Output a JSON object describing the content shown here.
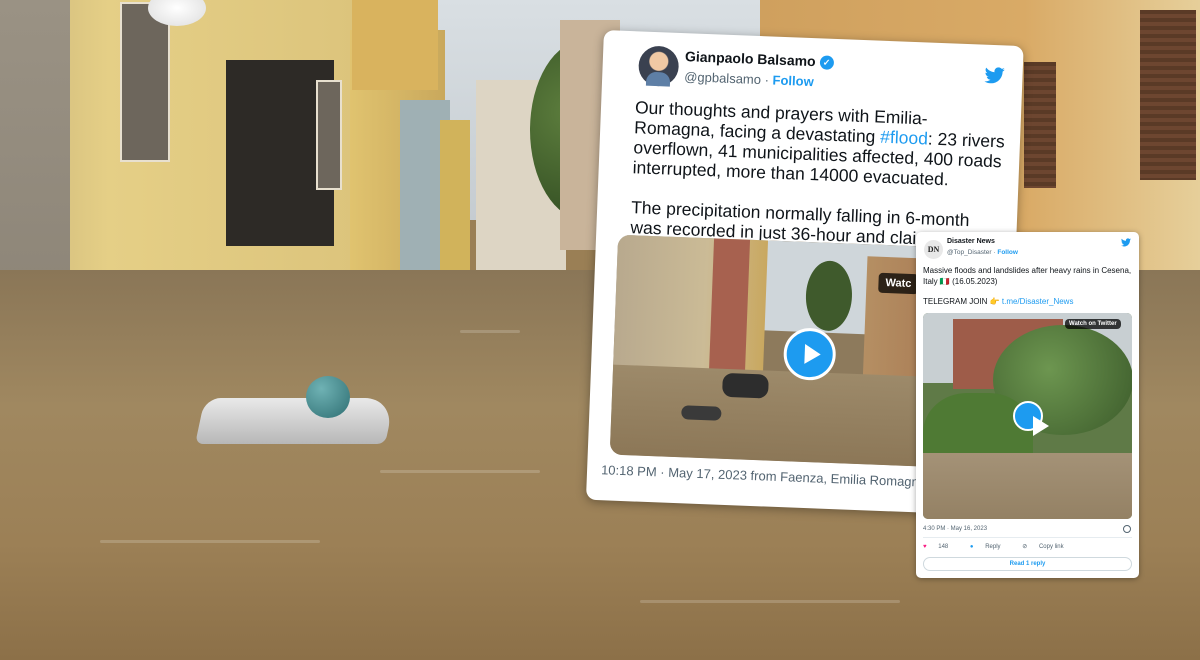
{
  "main_tweet": {
    "author_name": "Gianpaolo Balsamo",
    "verified_mark": "✓",
    "handle": "@gpbalsamo",
    "separator": "·",
    "follow_label": "Follow",
    "text_before_hashtag": "Our thoughts and prayers with Emilia-Romagna, facing a devastating ",
    "hashtag": "#flood",
    "text_after_hashtag": ": 23 rivers overflown, 41 municipalities affected, 400 roads interrupted, more than 14000 evacuated.",
    "text_paragraph_2": "The precipitation normally falling in 6-month was recorded in just 36-hour and claimed already 9 lives.",
    "video_badge": "Watc",
    "timestamp": "10:18 PM · May 17, 2023 from Faenza, Emilia Romagna"
  },
  "embedded_tweet": {
    "logo_text": "DN",
    "author_name": "Disaster News",
    "handle": "@Top_Disaster",
    "separator": "·",
    "follow_label": "Follow",
    "text_line_1": "Massive floods and landslides after heavy rains in Cesena, Italy 🇮🇹 (16.05.2023)",
    "telegram_label": "TELEGRAM JOIN 👉",
    "telegram_link": "t.me/Disaster_News",
    "video_badge": "Watch on Twitter",
    "timestamp": "4:30 PM · May 16, 2023",
    "like_icon": "♥",
    "like_count": "148",
    "reply_label": "Reply",
    "copy_link_label": "Copy link",
    "read_replies_label": "Read 1 reply"
  },
  "icons": {
    "twitter_bird_color": "#1d9bf0",
    "play_button_color": "#1d9bf0"
  }
}
